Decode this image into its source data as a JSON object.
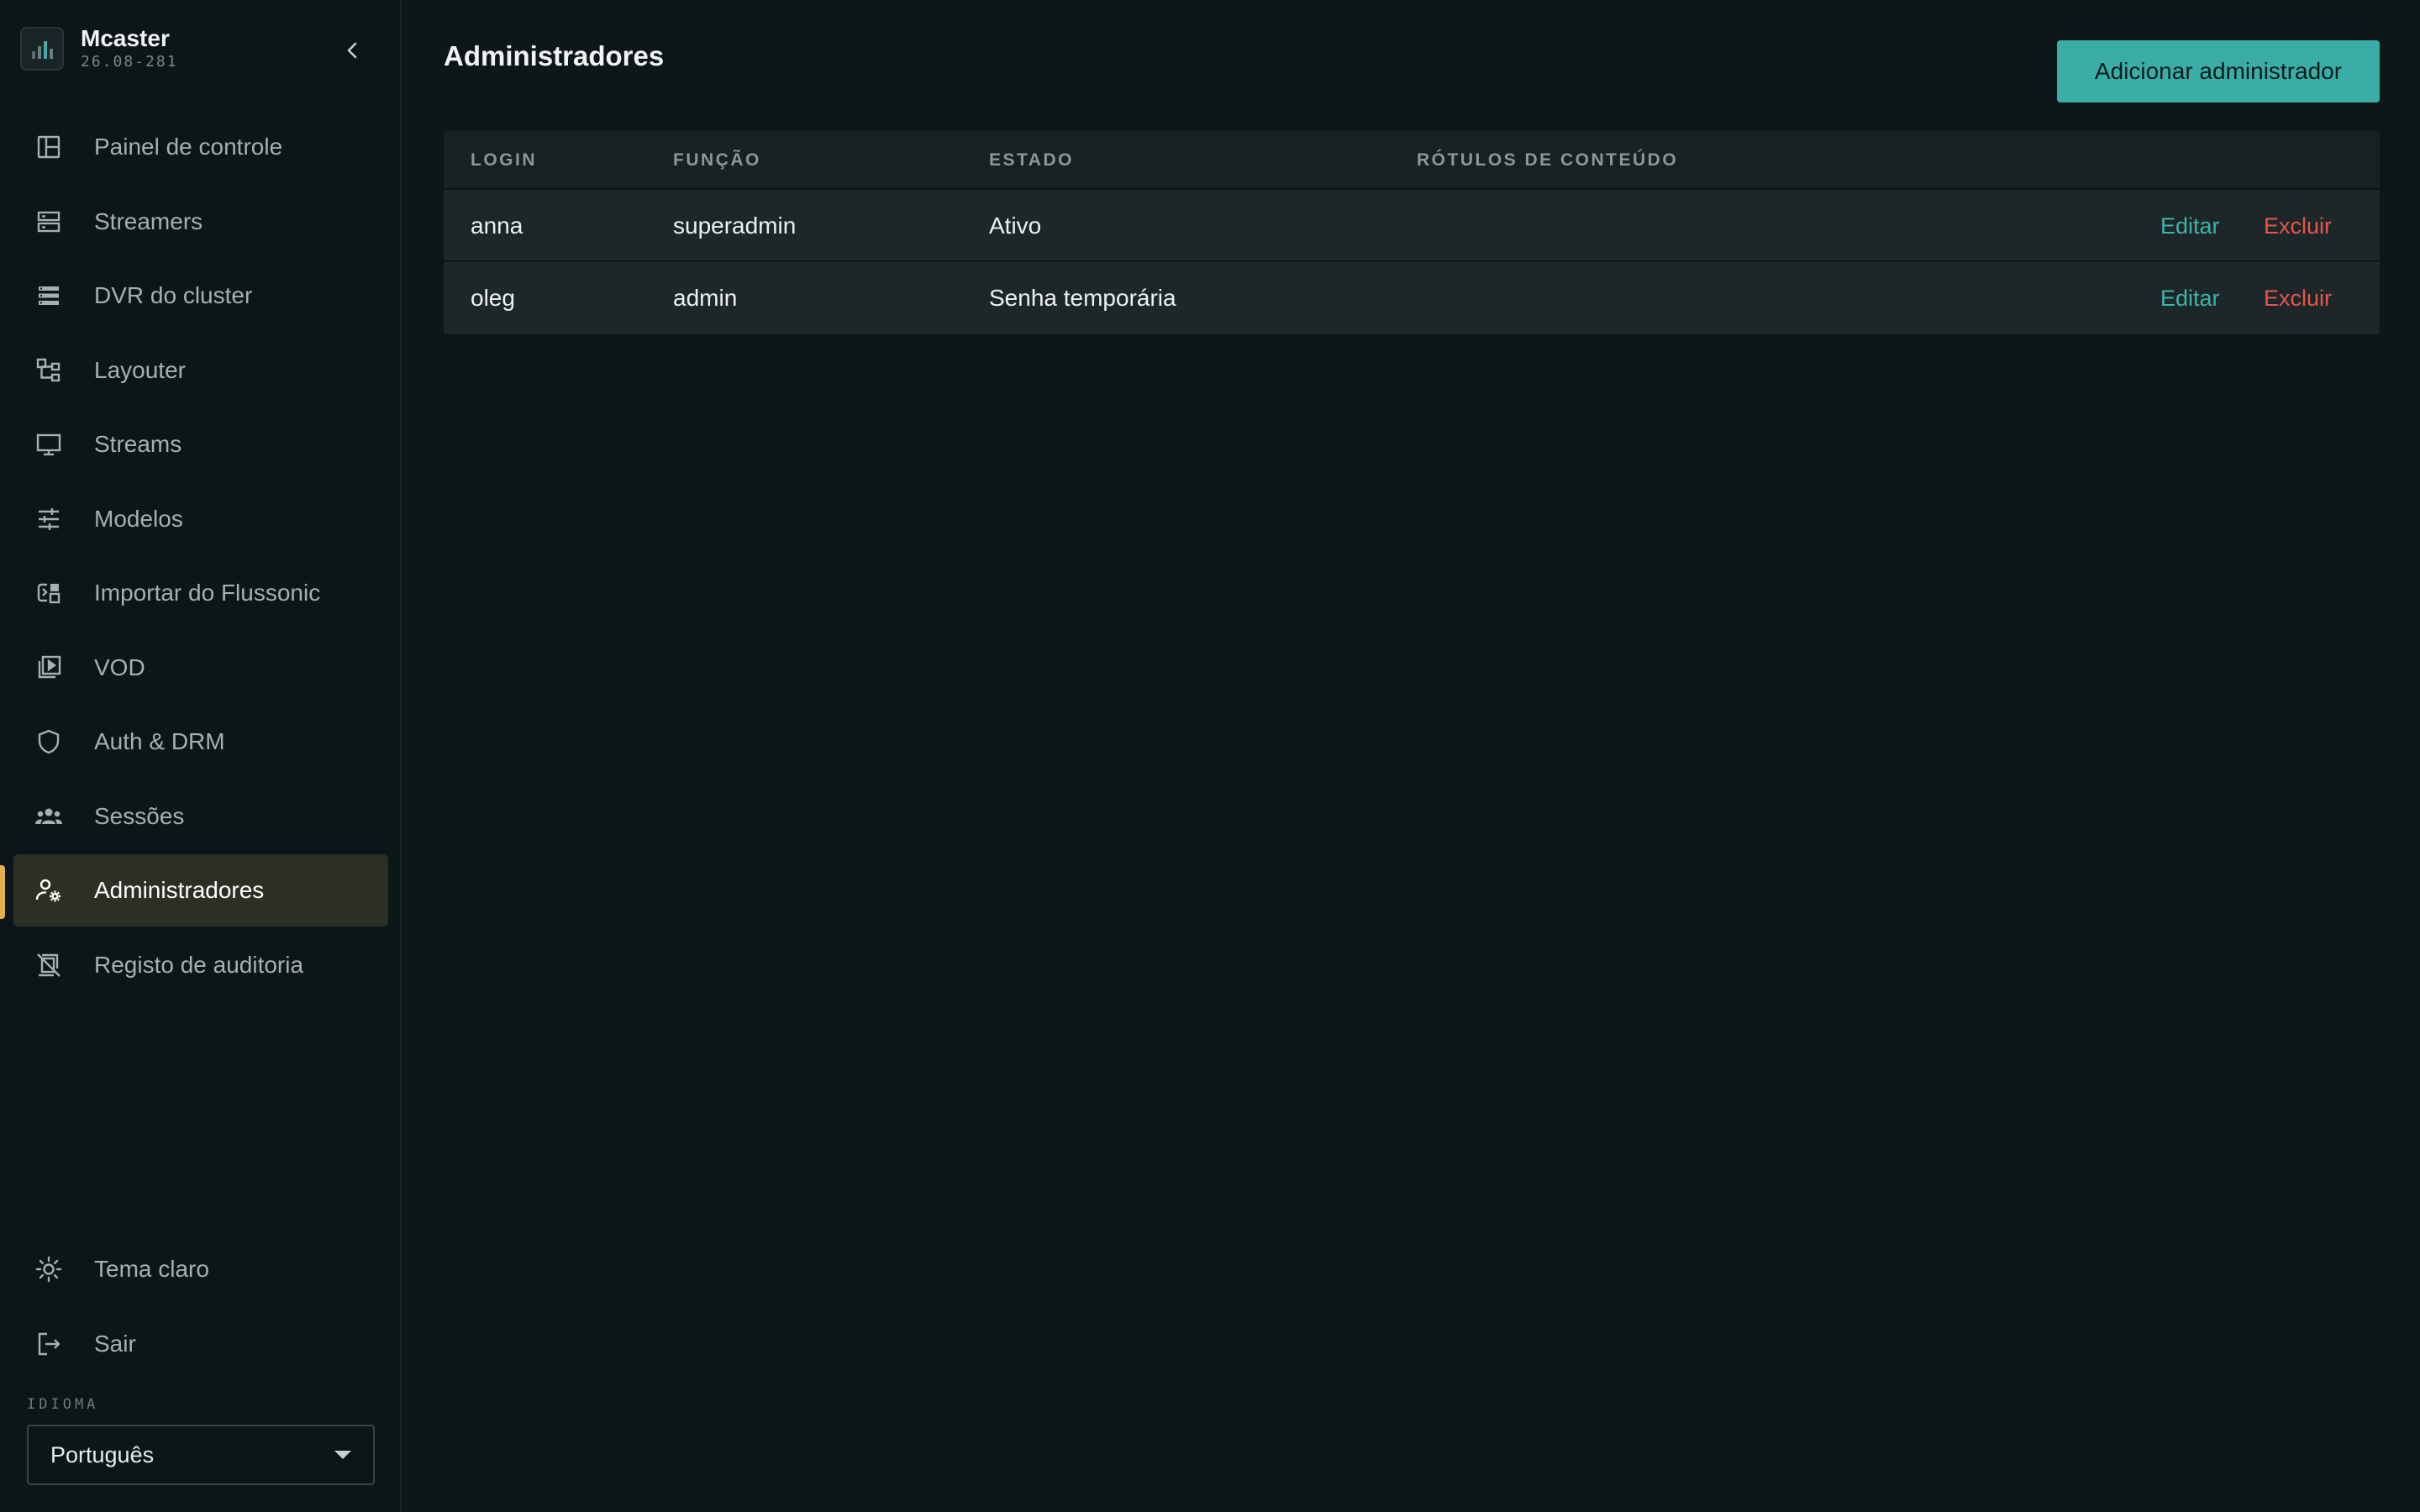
{
  "brand": {
    "name": "Mcaster",
    "version": "26.08-281"
  },
  "nav": {
    "items": [
      {
        "label": "Painel de controle",
        "icon": "dashboard-icon"
      },
      {
        "label": "Streamers",
        "icon": "server-icon"
      },
      {
        "label": "DVR do cluster",
        "icon": "storage-icon"
      },
      {
        "label": "Layouter",
        "icon": "layout-icon"
      },
      {
        "label": "Streams",
        "icon": "monitor-icon"
      },
      {
        "label": "Modelos",
        "icon": "sliders-icon"
      },
      {
        "label": "Importar do Flussonic",
        "icon": "import-icon"
      },
      {
        "label": "VOD",
        "icon": "video-library-icon"
      },
      {
        "label": "Auth & DRM",
        "icon": "shield-icon"
      },
      {
        "label": "Sessões",
        "icon": "group-icon"
      },
      {
        "label": "Administradores",
        "icon": "admin-settings-icon",
        "active": true
      },
      {
        "label": "Registo de auditoria",
        "icon": "audit-icon"
      }
    ],
    "bottom": [
      {
        "label": "Tema claro",
        "icon": "sun-icon"
      },
      {
        "label": "Sair",
        "icon": "logout-icon"
      }
    ],
    "active_color": "#e3b04b"
  },
  "language": {
    "label": "IDIOMA",
    "selected": "Português"
  },
  "main": {
    "title": "Administradores",
    "add_button": "Adicionar administrador",
    "accent": "#3aaea6"
  },
  "table": {
    "columns": [
      "LOGIN",
      "FUNÇÃO",
      "ESTADO",
      "RÓTULOS DE CONTEÚDO"
    ],
    "rows": [
      {
        "login": "anna",
        "role": "superadmin",
        "status": "Ativo",
        "labels": "",
        "edit": "Editar",
        "delete": "Excluir"
      },
      {
        "login": "oleg",
        "role": "admin",
        "status": "Senha temporária",
        "labels": "",
        "edit": "Editar",
        "delete": "Excluir"
      }
    ]
  }
}
